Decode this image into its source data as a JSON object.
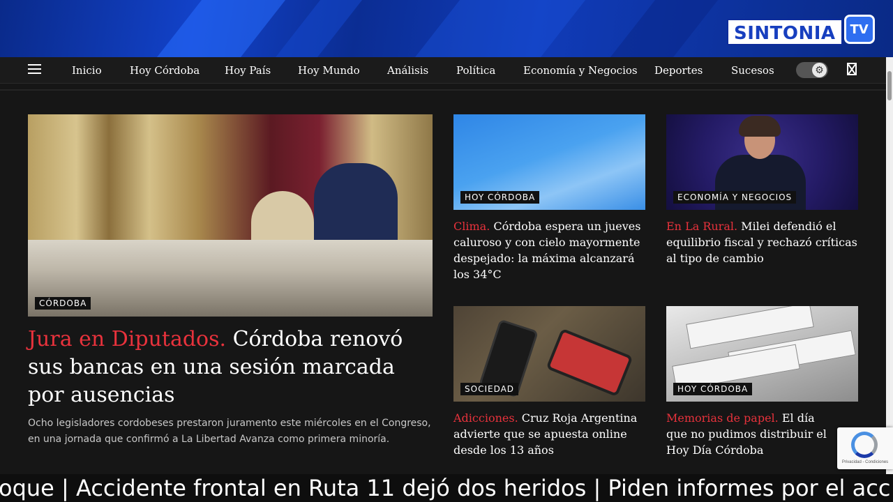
{
  "logo": {
    "main": "SINTONIA",
    "tv": "TV"
  },
  "nav": {
    "items": [
      {
        "label": "Inicio"
      },
      {
        "label": "Hoy Córdoba"
      },
      {
        "label": "Hoy País"
      },
      {
        "label": "Hoy Mundo"
      },
      {
        "label": "Análisis"
      },
      {
        "label": "Política"
      },
      {
        "label": "Economía y Negocios"
      },
      {
        "label": "Deportes"
      },
      {
        "label": "Sucesos"
      }
    ],
    "theme_toggle_icon": "gear-icon"
  },
  "main_article": {
    "tag": "CÓRDOBA",
    "kicker": "Jura en Diputados.",
    "title": "Córdoba renovó sus bancas en una sesión marcada por ausencias",
    "excerpt": "Ocho legisladores cordobeses prestaron juramento este miércoles en el Congreso, en una jornada que confirmó a La Libertad Avanza como primera minoría."
  },
  "articles": [
    {
      "tag": "HOY CÓRDOBA",
      "kicker": "Clima.",
      "title": "Córdoba espera un jueves caluroso y con cielo mayormente despejado: la máxima alcanzará los 34°C"
    },
    {
      "tag": "ECONOMÍA Y NEGOCIOS",
      "kicker": "En La Rural.",
      "title": "Milei defendió el equilibrio fiscal y rechazó críticas al tipo de cambio"
    },
    {
      "tag": "SOCIEDAD",
      "kicker": "Adicciones.",
      "title": "Cruz Roja Argentina advierte que se apuesta online desde los 13 años"
    },
    {
      "tag": "HOY CÓRDOBA",
      "kicker": "Memorias de papel.",
      "title": "El día que no pudimos distribuir el Hoy Día Córdoba"
    }
  ],
  "recaptcha": {
    "text": "Privacidad - Condiciones"
  },
  "ticker": {
    "text": "oque | Accidente frontal en Ruta 11 dejó dos heridos | Piden informes por el acc"
  }
}
